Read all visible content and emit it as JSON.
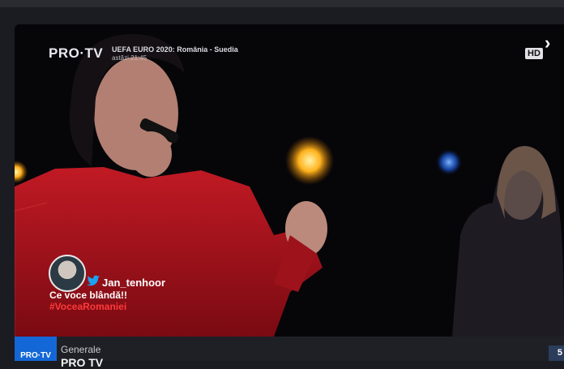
{
  "player": {
    "logo": "PRO·TV",
    "match_title": "UEFA EURO 2020: România - Suedia",
    "match_time": "astăzi 21:45",
    "hd_badge": "HD",
    "next_icon": "chevron-right-icon"
  },
  "tweet": {
    "avatar": "user-avatar",
    "bird_icon": "twitter-bird-icon",
    "handle": "Jan_tenhoor",
    "text": "Ce voce blândă!!",
    "hashtag": "#VoceaRomaniei"
  },
  "channel": {
    "logo_text": "PRO·TV",
    "category": "Generale",
    "name": "PRO TV",
    "side_label": "5"
  },
  "colors": {
    "accent_blue": "#1467d6",
    "hashtag_red": "#ff3a3a",
    "background": "#1b1c22"
  }
}
